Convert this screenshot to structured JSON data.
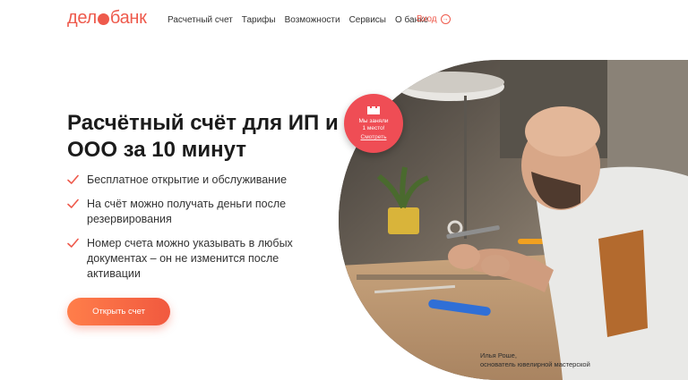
{
  "brand": {
    "name_part1": "дел",
    "name_part2": "банк"
  },
  "nav": {
    "items": [
      "Расчетный счет",
      "Тарифы",
      "Возможности",
      "Сервисы",
      "О банке"
    ],
    "login_label": "Вход"
  },
  "hero": {
    "title": "Расчётный счёт для ИП и ООО за 10 минут",
    "features": [
      "Бесплатное открытие и обслуживание",
      "На счёт можно получать деньги после резервирования",
      "Номер счета можно указывать в любых документах – он не изменится после активации"
    ],
    "cta_label": "Открыть счет"
  },
  "badge": {
    "line1": "Мы заняли",
    "line2": "1 место!",
    "link": "Смотреть"
  },
  "photo_caption": {
    "name": "Илья Роше,",
    "role": "основатель ювелирной мастерской"
  },
  "colors": {
    "accent": "#ee5a4c",
    "badge": "#ef4d55",
    "cta_start": "#ff7e4a",
    "cta_end": "#f1593f"
  }
}
